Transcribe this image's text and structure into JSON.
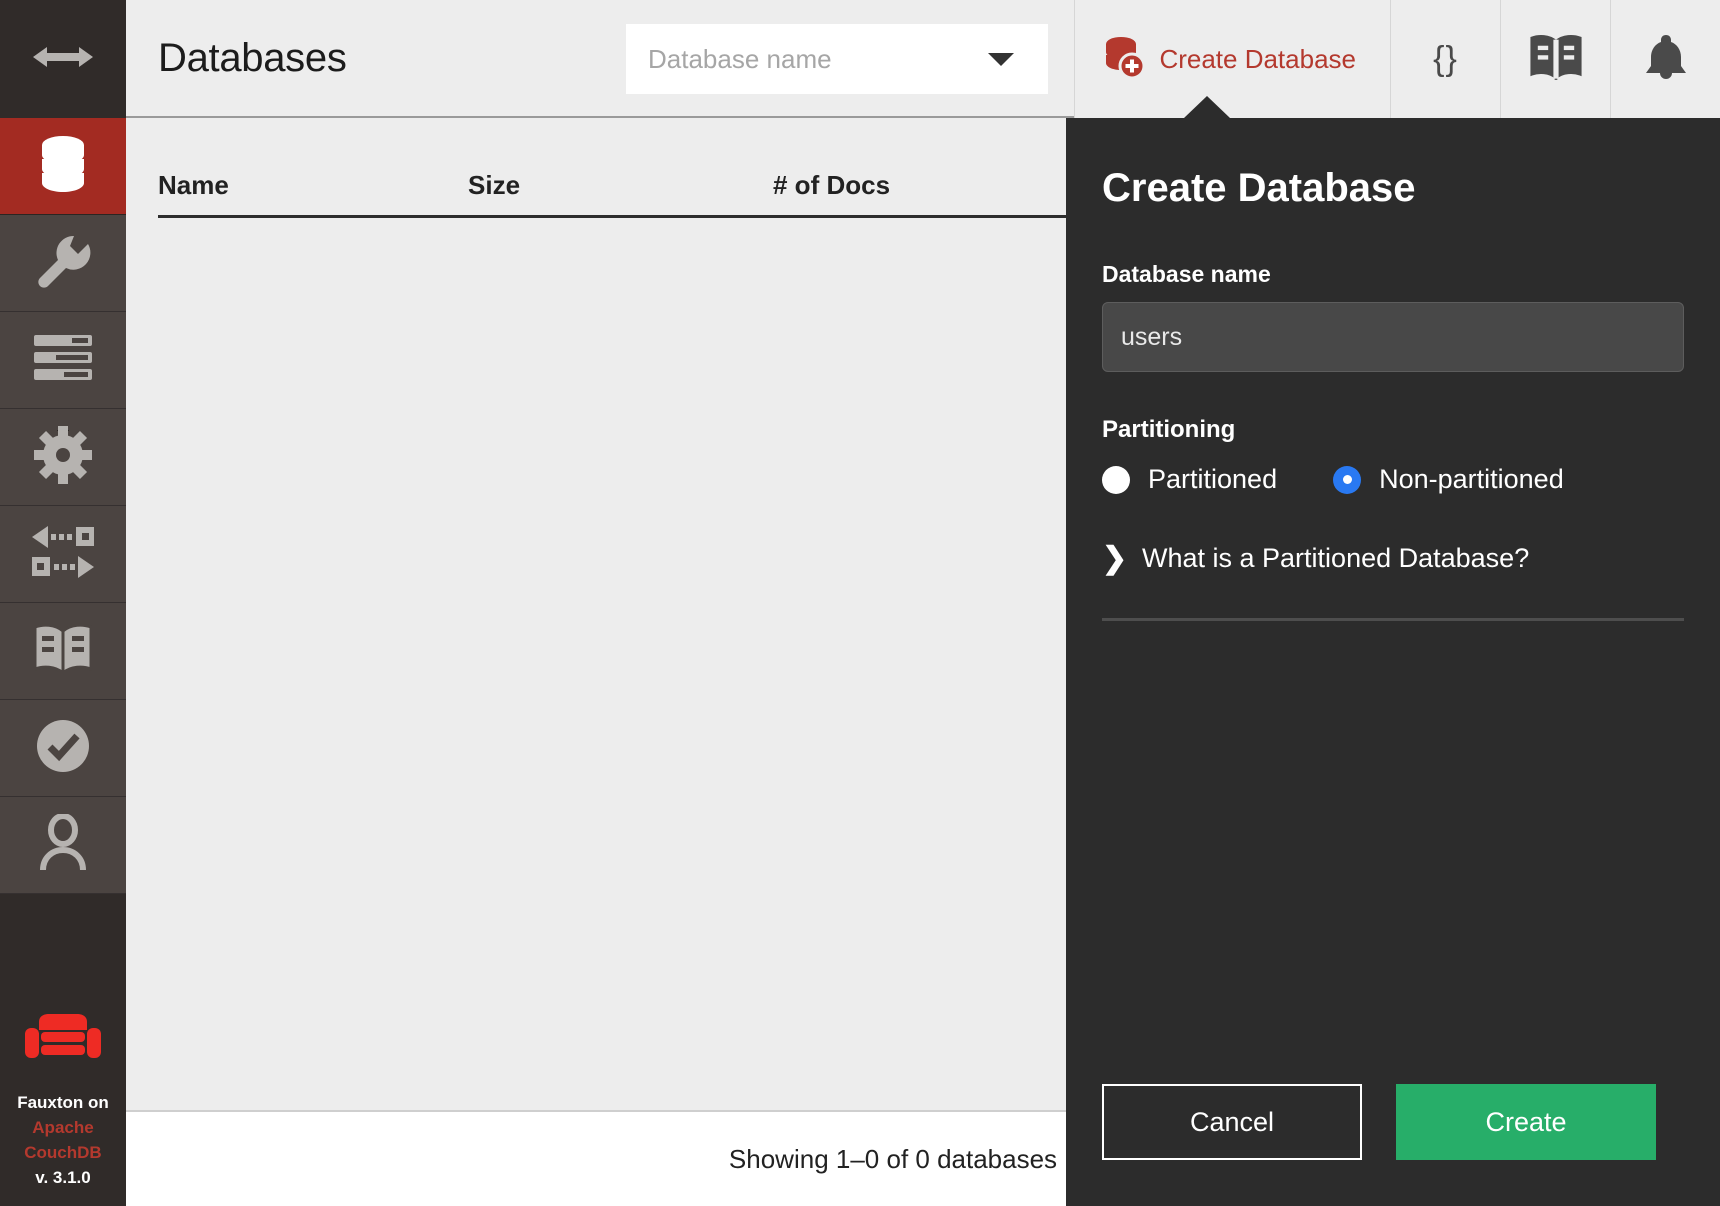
{
  "sidebar": {
    "toggle_icon": "resize-horizontal-icon",
    "items": [
      {
        "name": "databases",
        "icon": "database-icon",
        "active": true
      },
      {
        "name": "setup",
        "icon": "wrench-icon",
        "active": false
      },
      {
        "name": "active-tasks",
        "icon": "server-list-icon",
        "active": false
      },
      {
        "name": "configuration",
        "icon": "gear-icon",
        "active": false
      },
      {
        "name": "replication",
        "icon": "replication-arrows-icon",
        "active": false
      },
      {
        "name": "documentation",
        "icon": "book-icon",
        "active": false
      },
      {
        "name": "verify",
        "icon": "check-circle-icon",
        "active": false
      },
      {
        "name": "account",
        "icon": "user-icon",
        "active": false
      }
    ],
    "brand": {
      "logo_icon": "couch-logo-icon",
      "line1": "Fauxton on",
      "line2": "Apache",
      "line3": "CouchDB",
      "version": "v. 3.1.0"
    }
  },
  "header": {
    "title": "Databases",
    "search": {
      "value": "",
      "placeholder": "Database name",
      "caret_icon": "chevron-down-icon"
    },
    "toolbar": {
      "create_database_label": "Create Database",
      "create_database_icon": "database-plus-icon",
      "json_icon": "{}",
      "docs_icon": "book-icon",
      "notifications_icon": "bell-icon"
    }
  },
  "table": {
    "columns": [
      "Name",
      "Size",
      "# of Docs"
    ],
    "rows": []
  },
  "footer": {
    "status": "Showing 1–0 of 0 databases"
  },
  "panel": {
    "title": "Create Database",
    "name_label": "Database name",
    "name_value": "users",
    "name_placeholder": "Database name",
    "partitioning_label": "Partitioning",
    "options": [
      {
        "label": "Partitioned",
        "selected": false
      },
      {
        "label": "Non-partitioned",
        "selected": true
      }
    ],
    "help_link": "What is a Partitioned Database?",
    "help_icon": "chevron-right-icon",
    "cancel_label": "Cancel",
    "create_label": "Create"
  },
  "colors": {
    "brand_red": "#B4392E",
    "sidebar_active": "#A32B22",
    "panel_bg": "#2c2c2c",
    "create_green": "#27AE69",
    "radio_blue": "#2979F2"
  }
}
